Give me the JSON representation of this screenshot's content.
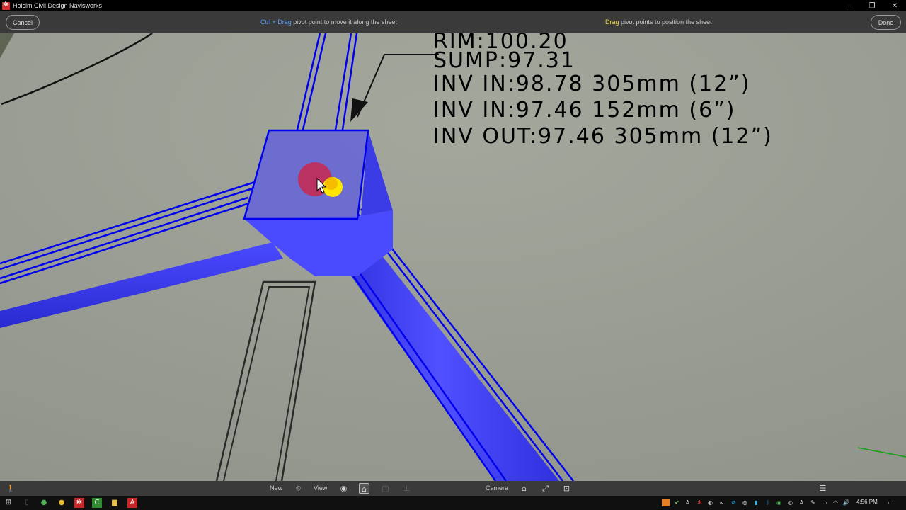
{
  "window": {
    "title": "Holcim Civil Design Navisworks",
    "controls": [
      "minimize-icon",
      "restore-icon",
      "close-icon"
    ]
  },
  "toolbar": {
    "cancel_label": "Cancel",
    "done_label": "Done",
    "hint_left": {
      "key": "Ctrl + Drag",
      "text": " pivot point to move it along the sheet"
    },
    "hint_right": {
      "key": "Drag",
      "text": " pivot points to position the sheet"
    }
  },
  "annotation": {
    "rim": "RIM:100.20",
    "sump": "SUMP:97.31",
    "inv_in_1": "INV  IN:98.78  305mm  (12”)",
    "inv_in_2": "INV  IN:97.46  152mm  (6”)",
    "inv_out": "INV  OUT:97.46  305mm  (12”)"
  },
  "navbar": {
    "new_label": "New",
    "view_label": "View",
    "camera_label": "Camera",
    "icons": [
      "walk-icon",
      "location-pin-icon",
      "eye-icon",
      "sheet-pivot-icon",
      "cube-icon",
      "measure-icon",
      "home-icon",
      "fit-view-icon",
      "focus-icon",
      "menu-icon"
    ]
  },
  "taskbar": {
    "time": "4:56 PM",
    "apps": [
      "windows-start-icon",
      "chrome-icon",
      "chrome-icon",
      "navisworks-icon",
      "civil3d-icon",
      "file-explorer-icon",
      "autocad-icon"
    ]
  },
  "colors": {
    "viewport": "#9fa398",
    "pipe_blue": "#3838ff",
    "outline_blue": "#0000ee",
    "pivot_red": "#c8284e",
    "pivot_yellow": "#ffe600",
    "hint_blue": "#5aa0ff",
    "hint_yellow": "#f0e040"
  }
}
